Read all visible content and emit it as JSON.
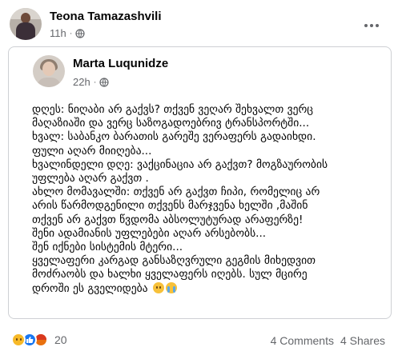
{
  "post": {
    "author": "Teona Tamazashvili",
    "time": "11h",
    "dot": "·"
  },
  "shared": {
    "author": "Marta Luqunidze",
    "time": "22h",
    "dot": "·",
    "lines": [
      "დღეს: ნიღაბი არ გაქვს? თქვენ ვეღარ შეხვალთ ვერც",
      "მაღაზიაში და ვერც საზოგადოებრივ ტრანსპორტში...",
      "ხვალ: საბანკო ბარათის გარეშე ვერაფერს გადაიხდი.",
      "ფული აღარ მიიღება...",
      "ხვალინდელი დღე: ვაქცინაცია არ გაქვთ? მოგზაურობის",
      "უფლება აღარ გაქვთ .",
      "ახლო მომავალში: თქვენ არ გაქვთ ჩიპი, რომელიც არ",
      "არის წარმოდგენილი თქვენს მარჯვენა ხელში ,მაშინ",
      "თქვენ არ გაქვთ წვდომა აბსოლუტურად არაფერზე!",
      "შენი ადამიანის უფლებები აღარ არსებობს...",
      "შენ იქნები სისტემის მტერი...",
      "ყველაფერი კარგად განსაზღვრული გეგმის მიხედვით",
      "მოძრაობს და ხალხი ყველაფერს იღებს. სულ მცირე",
      "დროში ეს გველიდება"
    ]
  },
  "footer": {
    "reaction_count": "20",
    "comments": "4 Comments",
    "shares": "4 Shares"
  },
  "colors": {
    "secondary_text": "#65676b",
    "like_blue": "#1877f2",
    "card_border": "#ced0d4"
  }
}
